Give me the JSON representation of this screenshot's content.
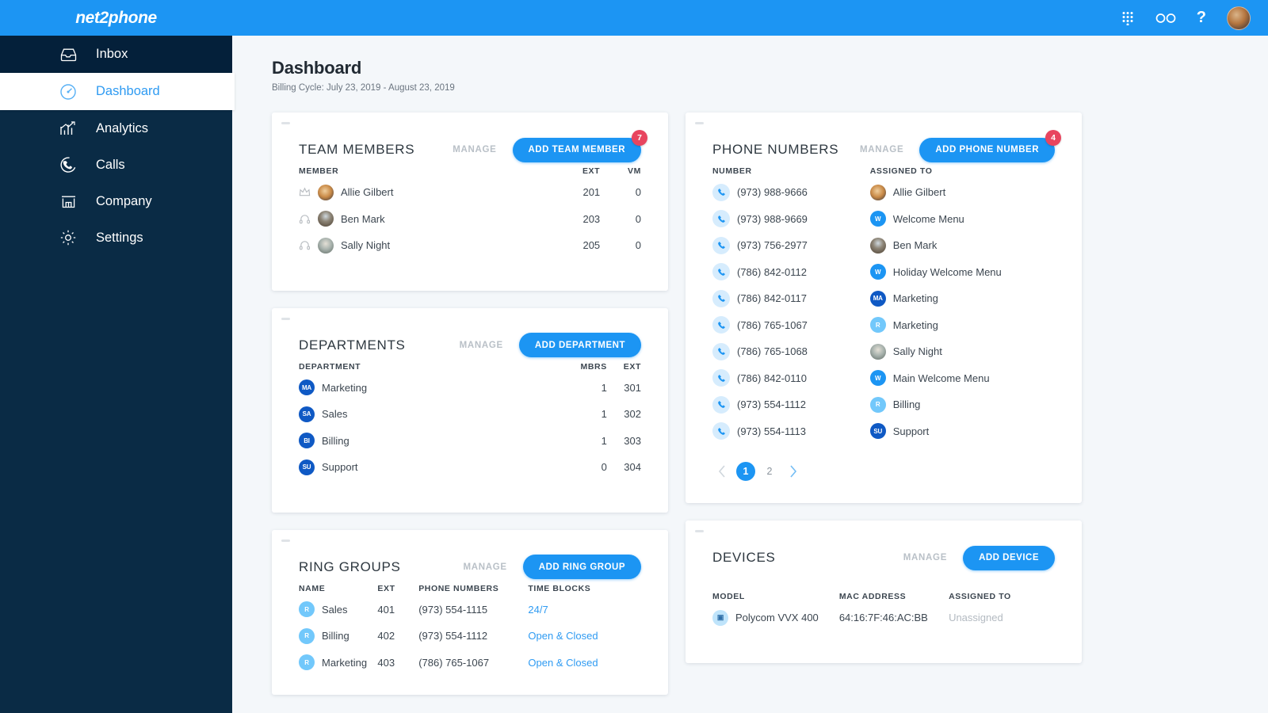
{
  "brand": {
    "logo": "net2phone",
    "accent": "#1c95f3",
    "sidebar_bg": "#0a2b45",
    "badge_color": "#e8455f"
  },
  "topbar": {
    "icons": [
      {
        "name": "dialpad-icon",
        "label": "Dialpad"
      },
      {
        "name": "voicemail-icon",
        "label": "Voicemail"
      },
      {
        "name": "help-icon",
        "label": "?"
      }
    ],
    "avatar": "user-avatar"
  },
  "sidebar": {
    "items": [
      {
        "label": "Inbox",
        "icon": "inbox-icon",
        "active": false
      },
      {
        "label": "Dashboard",
        "icon": "gauge-icon",
        "active": true
      },
      {
        "label": "Analytics",
        "icon": "bar-chart-icon",
        "active": false
      },
      {
        "label": "Calls",
        "icon": "phone-circle-icon",
        "active": false
      },
      {
        "label": "Company",
        "icon": "store-icon",
        "active": false
      },
      {
        "label": "Settings",
        "icon": "gear-icon",
        "active": false
      }
    ]
  },
  "page": {
    "title": "Dashboard",
    "billing_cycle": "Billing Cycle: July 23, 2019 - August 23, 2019"
  },
  "cards": {
    "team_members": {
      "title": "TEAM MEMBERS",
      "manage_label": "MANAGE",
      "add_label": "ADD TEAM MEMBER",
      "badge": "7",
      "columns": [
        "MEMBER",
        "EXT",
        "VM"
      ],
      "rows": [
        {
          "name": "Allie Gilbert",
          "ext": "201",
          "vm": "0",
          "role_icon": "crown-icon",
          "avatar": "av-allie"
        },
        {
          "name": "Ben Mark",
          "ext": "203",
          "vm": "0",
          "role_icon": "headset-icon",
          "avatar": "av-ben"
        },
        {
          "name": "Sally Night",
          "ext": "205",
          "vm": "0",
          "role_icon": "headset-icon",
          "avatar": "av-sally"
        }
      ]
    },
    "departments": {
      "title": "DEPARTMENTS",
      "manage_label": "MANAGE",
      "add_label": "ADD DEPARTMENT",
      "columns": [
        "DEPARTMENT",
        "MBRS",
        "EXT"
      ],
      "rows": [
        {
          "name": "Marketing",
          "initials": "MA",
          "mbrs": "1",
          "ext": "301"
        },
        {
          "name": "Sales",
          "initials": "SA",
          "mbrs": "1",
          "ext": "302"
        },
        {
          "name": "Billing",
          "initials": "BI",
          "mbrs": "1",
          "ext": "303"
        },
        {
          "name": "Support",
          "initials": "SU",
          "mbrs": "0",
          "ext": "304"
        }
      ]
    },
    "ring_groups": {
      "title": "RING GROUPS",
      "manage_label": "MANAGE",
      "add_label": "ADD RING GROUP",
      "columns": [
        "NAME",
        "EXT",
        "PHONE NUMBERS",
        "TIME BLOCKS"
      ],
      "rows": [
        {
          "name": "Sales",
          "initials": "R",
          "ext": "401",
          "phone": "(973) 554-1115",
          "time_block": "24/7"
        },
        {
          "name": "Billing",
          "initials": "R",
          "ext": "402",
          "phone": "(973) 554-1112",
          "time_block": "Open & Closed"
        },
        {
          "name": "Marketing",
          "initials": "R",
          "ext": "403",
          "phone": "(786) 765-1067",
          "time_block": "Open & Closed"
        }
      ]
    },
    "phone_numbers": {
      "title": "PHONE NUMBERS",
      "manage_label": "MANAGE",
      "add_label": "ADD PHONE NUMBER",
      "badge": "4",
      "columns": [
        "NUMBER",
        "ASSIGNED TO"
      ],
      "rows": [
        {
          "number": "(973) 988-9666",
          "assigned_to": "Allie Gilbert",
          "kind": "avatar",
          "avatar": "av-allie"
        },
        {
          "number": "(973) 988-9669",
          "assigned_to": "Welcome Menu",
          "kind": "initials",
          "initials": "W",
          "style": "menu"
        },
        {
          "number": "(973) 756-2977",
          "assigned_to": "Ben Mark",
          "kind": "avatar",
          "avatar": "av-ben"
        },
        {
          "number": "(786) 842-0112",
          "assigned_to": "Holiday Welcome Menu",
          "kind": "initials",
          "initials": "W",
          "style": "menu"
        },
        {
          "number": "(786) 842-0117",
          "assigned_to": "Marketing",
          "kind": "initials",
          "initials": "MA",
          "style": "dept"
        },
        {
          "number": "(786) 765-1067",
          "assigned_to": "Marketing",
          "kind": "initials",
          "initials": "R",
          "style": "ring"
        },
        {
          "number": "(786) 765-1068",
          "assigned_to": "Sally Night",
          "kind": "avatar",
          "avatar": "av-sally"
        },
        {
          "number": "(786) 842-0110",
          "assigned_to": "Main Welcome Menu",
          "kind": "initials",
          "initials": "W",
          "style": "menu"
        },
        {
          "number": "(973) 554-1112",
          "assigned_to": "Billing",
          "kind": "initials",
          "initials": "R",
          "style": "ring"
        },
        {
          "number": "(973) 554-1113",
          "assigned_to": "Support",
          "kind": "initials",
          "initials": "SU",
          "style": "dept"
        }
      ],
      "pagination": {
        "prev": "‹",
        "pages": [
          "1",
          "2"
        ],
        "current": "1",
        "next": "›"
      }
    },
    "devices": {
      "title": "DEVICES",
      "manage_label": "MANAGE",
      "add_label": "ADD DEVICE",
      "columns": [
        "MODEL",
        "MAC ADDRESS",
        "ASSIGNED TO"
      ],
      "rows": [
        {
          "model": "Polycom VVX 400",
          "mac": "64:16:7F:46:AC:BB",
          "assigned_to": "Unassigned",
          "icon": "device-icon"
        }
      ]
    }
  }
}
